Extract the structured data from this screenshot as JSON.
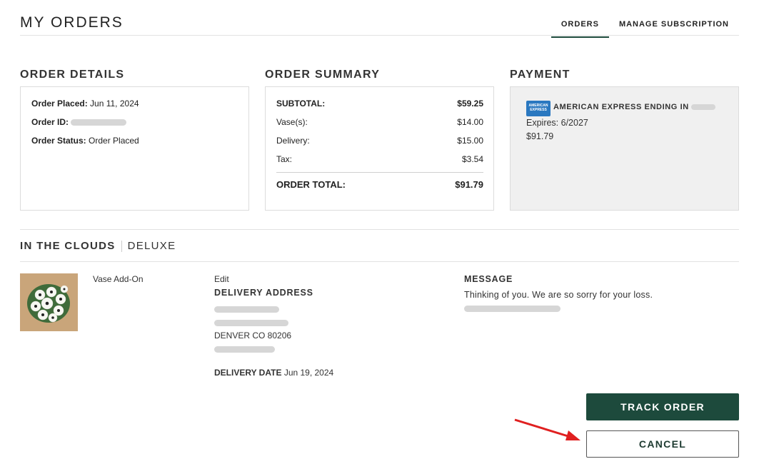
{
  "header": {
    "title": "MY ORDERS",
    "tabs": [
      {
        "label": "ORDERS"
      },
      {
        "label": "MANAGE SUBSCRIPTION"
      }
    ]
  },
  "order_details": {
    "heading": "ORDER DETAILS",
    "placed_label": "Order Placed:",
    "placed_value": "Jun 11, 2024",
    "id_label": "Order ID:",
    "status_label": "Order Status:",
    "status_value": "Order Placed"
  },
  "order_summary": {
    "heading": "ORDER SUMMARY",
    "rows": [
      {
        "label": "SUBTOTAL:",
        "value": "$59.25"
      },
      {
        "label": "Vase(s):",
        "value": "$14.00"
      },
      {
        "label": "Delivery:",
        "value": "$15.00"
      },
      {
        "label": "Tax:",
        "value": "$3.54"
      }
    ],
    "total_label": "ORDER TOTAL:",
    "total_value": "$91.79"
  },
  "payment": {
    "heading": "PAYMENT",
    "card_logo_text": "AMERICAN EXPRESS",
    "card_label": "AMERICAN EXPRESS ENDING IN",
    "expires": "Expires: 6/2027",
    "amount": "$91.79"
  },
  "product": {
    "name": "IN THE CLOUDS",
    "tier": "DELUXE",
    "addon": "Vase Add-On",
    "edit_label": "Edit",
    "delivery_address_label": "DELIVERY ADDRESS",
    "city_line": "DENVER CO 80206",
    "delivery_date_label": "DELIVERY DATE",
    "delivery_date": "Jun 19, 2024",
    "message_label": "MESSAGE",
    "message_text": "Thinking of you. We are so sorry for your loss."
  },
  "actions": {
    "track": "TRACK ORDER",
    "cancel": "CANCEL"
  },
  "colors": {
    "brand_green": "#1d4a3c",
    "annotation_red": "#e02020"
  }
}
